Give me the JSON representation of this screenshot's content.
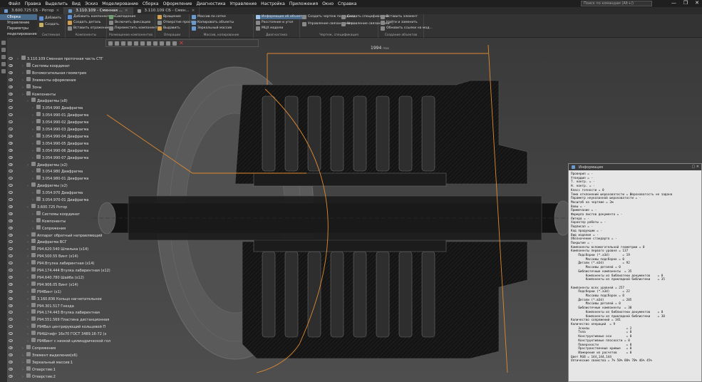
{
  "menu": [
    "Файл",
    "Правка",
    "Выделить",
    "Вид",
    "Эскиз",
    "Моделирование",
    "Сборка",
    "Оформление",
    "Диагностика",
    "Управление",
    "Настройка",
    "Приложения",
    "Окно",
    "Справка"
  ],
  "search_placeholder": "Поиск по командам (Alt+/)",
  "window_buttons": [
    "—",
    "❐",
    "✕"
  ],
  "tabs": [
    {
      "label": "3.600.725 СБ - Ротор"
    },
    {
      "label": "3.110.109 - Сменная ..."
    },
    {
      "label": "3.110.109 СБ - Смен..."
    }
  ],
  "ribbon_left": [
    "Сборка",
    "Управление",
    "Параметры",
    "моделирование"
  ],
  "ribbon_groups": [
    {
      "label": "Системная",
      "buttons": [
        "Добавить",
        "Создать"
      ]
    },
    {
      "label": "Компоненты",
      "buttons": [
        "Добавить компонент из...",
        "Создать деталь",
        "Вставить отражение к..."
      ]
    },
    {
      "label": "Размещение компонентов",
      "buttons": [
        "Совпадение",
        "Включить фиксацию",
        "Переместить компонент"
      ]
    },
    {
      "label": "Операции",
      "buttons": [
        "Вращение",
        "Отверстие простое",
        "Выдавить"
      ]
    },
    {
      "label": "Массив, копирование",
      "buttons": [
        "Массив по сетке",
        "Копировать объекты",
        "Зеркальный массив"
      ]
    },
    {
      "label": "Диагностика",
      "buttons": [
        "Информация об объекте",
        "Расстояние и угол",
        "МЦХ модели"
      ]
    },
    {
      "label": "Чертеж, спецификация",
      "buttons": [
        "Создать чертеж по модели",
        "Управление связанными ч...",
        "Создать спецификацию",
        "Управление связанными ..."
      ]
    },
    {
      "label": "Создание объектов",
      "buttons": [
        "Вставить элемент",
        "Найти и заменить",
        "Обновить ссылки на мод..."
      ]
    }
  ],
  "tree_rows": [
    {
      "label": "3.110.109 Сменная проточная часть СТГ",
      "level": 0
    },
    {
      "label": "Системы координат",
      "level": 1
    },
    {
      "label": "Вспомогательная геометрия",
      "level": 1
    },
    {
      "label": "Элементы оформления",
      "level": 1
    },
    {
      "label": "Зоны",
      "level": 1
    },
    {
      "label": "Компоненты",
      "level": 1
    },
    {
      "label": "Диафрагмы (x8)",
      "level": 2
    },
    {
      "label": "3.054.990 Диафрагма",
      "level": 3
    },
    {
      "label": "3.054.990-01 Диафрагма",
      "level": 3
    },
    {
      "label": "3.054.990-02 Диафрагма",
      "level": 3
    },
    {
      "label": "3.054.990-03 Диафрагма",
      "level": 3
    },
    {
      "label": "3.054.990-04 Диафрагма",
      "level": 3
    },
    {
      "label": "3.054.990-05 Диафрагма",
      "level": 3
    },
    {
      "label": "3.054.990-06 Диафрагма",
      "level": 3
    },
    {
      "label": "3.054.990-07 Диафрагма",
      "level": 3
    },
    {
      "label": "Диафрагмы (x2)",
      "level": 2
    },
    {
      "label": "3.054.980 Диафрагма",
      "level": 3
    },
    {
      "label": "3.054.980-01 Диафрагма",
      "level": 3
    },
    {
      "label": "Диафрагмы (x2)",
      "level": 2
    },
    {
      "label": "3.054.970 Диафрагма",
      "level": 3
    },
    {
      "label": "3.054.970-01 Диафрагма",
      "level": 3
    },
    {
      "label": "3.600.725 Ротор",
      "level": 2
    },
    {
      "label": "Системы координат",
      "level": 3
    },
    {
      "label": "Компоненты",
      "level": 3
    },
    {
      "label": "Сопряжения",
      "level": 3
    },
    {
      "label": "Аппарат обратный направляющий",
      "level": 2
    },
    {
      "label": "Диафрагма ВСГ",
      "level": 2
    },
    {
      "label": "Р94.620.540 Шпилька (x14)",
      "level": 2
    },
    {
      "label": "Р94.500.55 Винт (x14)",
      "level": 2
    },
    {
      "label": "Р94.Втулка лабиринтная (x14)",
      "level": 2
    },
    {
      "label": "Р94.174.444 Втулка лабиринтная (x12)",
      "level": 2
    },
    {
      "label": "Р94.640.780 Шайба (x12)",
      "level": 2
    },
    {
      "label": "Р94.906.05 Винт (x14)",
      "level": 2
    },
    {
      "label": "Р94Винт (x1)",
      "level": 2
    },
    {
      "label": "3.160.836 Кольцо нагнетательное",
      "level": 2
    },
    {
      "label": "Р94.301.517 Гнезда",
      "level": 2
    },
    {
      "label": "Р94.174.443 Втулка лабиринтная",
      "level": 2
    },
    {
      "label": "Р94.551.569 Пластина дистанционная",
      "level": 2
    },
    {
      "label": "Р94Вал центрирующий кольцевой П",
      "level": 2
    },
    {
      "label": "Р94Штифт 16x70 ГОСТ 3489.16-72 (x",
      "level": 2
    },
    {
      "label": "Р94Винт с низкой цилиндрической гол",
      "level": 2
    },
    {
      "label": "Сопряжения",
      "level": 1
    },
    {
      "label": "Элемент выделения(x6)",
      "level": 1
    },
    {
      "label": "Зеркальный массив:1",
      "level": 1
    },
    {
      "label": "Отверстие:1",
      "level": 1
    },
    {
      "label": "Отверстие:2",
      "level": 1
    }
  ],
  "dimension_label": "1994",
  "dimension_unit": "max",
  "info_panel": {
    "title": "Информация",
    "lines": [
      "Проверил = -",
      "Утвердил = -",
      "Т. контр. = -",
      "Н. контр. = -",
      "Класс точности = 0",
      "Тема отклонений шероховатости = Шероховатость не задана",
      "Параметр неуказанной шероховатости = -",
      "Масштаб на чертеже = 2м",
      "Вовы = -",
      "Примечание = -",
      "Формула листов документа = -",
      "Литера = -",
      "Характер работы = -",
      "Подписал = -",
      "Код продукции = -",
      "Вид изделия = -",
      "Обозначение стандарта = -",
      "Покрытие = -",
      "Компоненты вспомогательной геометрии = 0",
      "Компоненты первого уровня = 137",
      "    Подсборки (*.a3d)       = 19",
      "        Массивы подсборок = 0",
      "    Детали (*.m3d)          = 92",
      "        Массивы деталей = 0",
      "    Библиотечные компоненты  = 35",
      "        Компоненты из библиотеки документов    = 0",
      "        Компоненты из прикладной библиотеки    = 35",
      "",
      "Компоненты всех уровней = 257",
      "    Подсборки (*.a3d)       = 22",
      "        Массивы подсборок = 0",
      "    Детали (*.m3d)          = 205",
      "        Массивы деталей = 0",
      "    Библиотечные компоненты  = 30",
      "        Компоненты из библиотеки документов    = 0",
      "        Компоненты из прикладной библиотеки    = 30",
      "Количество сопряжений = 341",
      "Количество операций  = 9",
      "    Эскизы                    = 2",
      "    Тела                      = 0",
      "    Конструктивные оси        = 0",
      "    Конструктивные плоскости = 0",
      "    Поверхности               = 0",
      "    Пространственные кривые   = 0",
      "    Измерения из расчетов     = 0",
      "Цвет RGB = 144,144,144",
      "Оптические свойства = 7% 50% 80% 70% 46% 45%"
    ]
  }
}
